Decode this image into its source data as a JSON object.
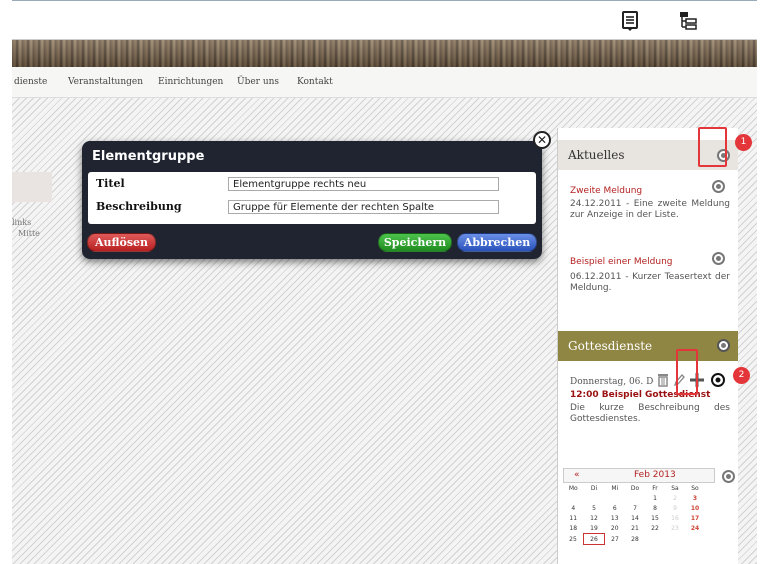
{
  "nav": {
    "items": [
      "dienste",
      "Veranstaltungen",
      "Einrichtungen",
      "Über uns",
      "Kontakt"
    ]
  },
  "left_fragments": [
    "links",
    "Mitte"
  ],
  "dialog": {
    "title": "Elementgruppe",
    "fields": [
      {
        "label": "Titel",
        "value": "Elementgruppe rechts neu"
      },
      {
        "label": "Beschreibung",
        "value": "Gruppe für Elemente der rechten Spalte"
      }
    ],
    "buttons": {
      "dissolve": "Auflösen",
      "save": "Speichern",
      "cancel": "Abbrechen"
    },
    "close_icon": "close-icon"
  },
  "aktuelles": {
    "title": "Aktuelles",
    "items": [
      {
        "title": "Zweite Meldung",
        "text": "24.12.2011 - Eine zweite Meldung zur Anzeige in der Liste."
      },
      {
        "title": "Beispiel einer Meldung",
        "text": "06.12.2011 - Kurzer Teasertext der Meldung."
      }
    ]
  },
  "gottesdienste": {
    "title": "Gottesdienste",
    "date": "Donnerstag, 06. Dez",
    "event_title": "12:00 Beispiel Gottesdienst",
    "event_text": "Die kurze Beschreibung des Gottesdienstes."
  },
  "calendar": {
    "prev": "«",
    "month": "Feb 2013",
    "weekdays": [
      "Mo",
      "Di",
      "Mi",
      "Do",
      "Fr",
      "Sa",
      "So"
    ],
    "weeks": [
      [
        "",
        "",
        "",
        "",
        "1",
        "2",
        "3"
      ],
      [
        "4",
        "5",
        "6",
        "7",
        "8",
        "9",
        "10"
      ],
      [
        "11",
        "12",
        "13",
        "14",
        "15",
        "16",
        "17"
      ],
      [
        "18",
        "19",
        "20",
        "21",
        "22",
        "23",
        "24"
      ],
      [
        "25",
        "26",
        "27",
        "28",
        "",
        "",
        ""
      ]
    ],
    "today": "26"
  },
  "annotations": [
    "1",
    "2"
  ],
  "colors": {
    "accent_red": "#e4363a",
    "dialog_bg": "#1f2430",
    "gottesdienste_header": "#8f8644",
    "news_link": "#b42222"
  }
}
